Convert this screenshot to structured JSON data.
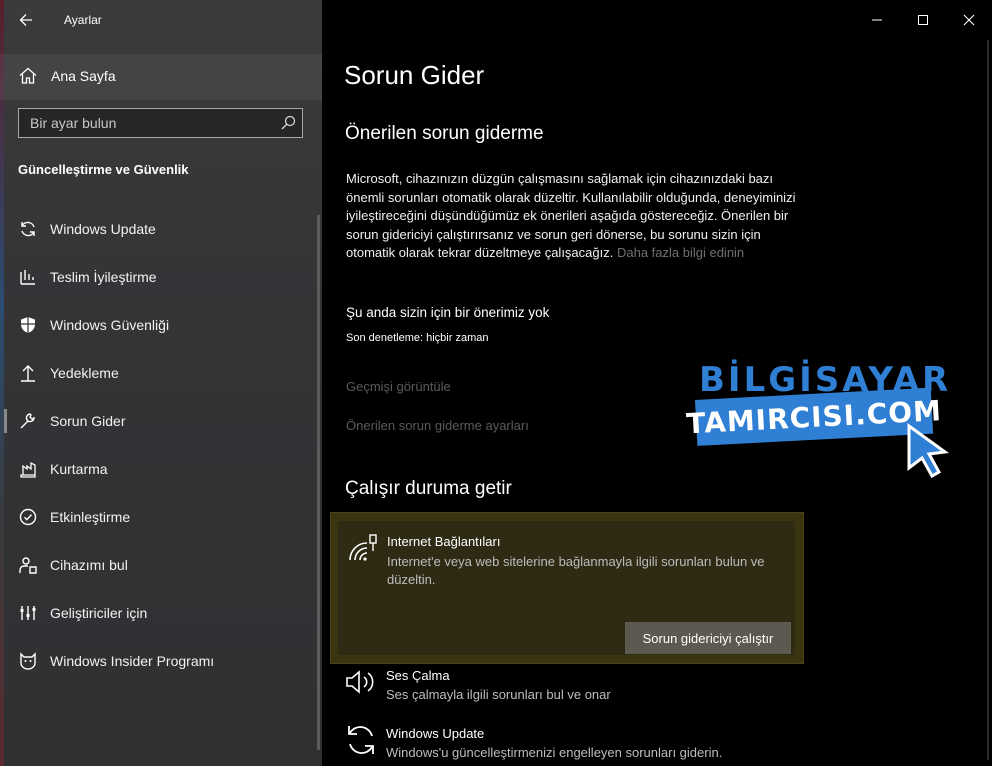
{
  "app": {
    "title": "Ayarlar",
    "home_label": "Ana Sayfa",
    "search_placeholder": "Bir ayar bulun",
    "section_title": "Güncelleştirme ve Güvenlik"
  },
  "sidebar": {
    "items": [
      {
        "label": "Windows Update",
        "icon": "refresh-icon"
      },
      {
        "label": "Teslim İyileştirme",
        "icon": "delivery-optimization-icon"
      },
      {
        "label": "Windows Güvenliği",
        "icon": "shield-icon"
      },
      {
        "label": "Yedekleme",
        "icon": "backup-arrow-icon"
      },
      {
        "label": "Sorun Gider",
        "icon": "wrench-icon"
      },
      {
        "label": "Kurtarma",
        "icon": "recovery-icon"
      },
      {
        "label": "Etkinleştirme",
        "icon": "check-circle-icon"
      },
      {
        "label": "Cihazımı bul",
        "icon": "person-location-icon"
      },
      {
        "label": "Geliştiriciler için",
        "icon": "developer-icon"
      },
      {
        "label": "Windows Insider Programı",
        "icon": "insider-cat-icon"
      }
    ]
  },
  "main": {
    "page_title": "Sorun Gider",
    "recommended_heading": "Önerilen sorun giderme",
    "description": "Microsoft, cihazınızın düzgün çalışmasını sağlamak için cihazınızdaki bazı önemli sorunları otomatik olarak düzeltir. Kullanılabilir olduğunda, deneyiminizi iyileştireceğini düşündüğümüz ek önerileri aşağıda göstereceğiz. Önerilen bir sorun gidericiyi çalıştırırsanız ve sorun geri dönerse, bu sorunu sizin için otomatik olarak tekrar düzeltmeye çalışacağız.",
    "learn_more": "Daha fazla bilgi edinin",
    "no_recommendation": "Şu anda sizin için bir önerimiz yok",
    "last_check": "Son denetleme: hiçbir zaman",
    "history_link": "Geçmişi görüntüle",
    "settings_link": "Önerilen sorun giderme ayarları",
    "get_running_heading": "Çalışır duruma getir",
    "troubleshooters": [
      {
        "title": "Internet Bağlantıları",
        "subtitle": "Internet'e veya web sitelerine bağlanmayla ilgili sorunları bulun ve düzeltin.",
        "button": "Sorun gidericiyi çalıştır",
        "icon": "wifi-icon"
      },
      {
        "title": "Ses Çalma",
        "subtitle": "Ses çalmayla ilgili sorunları bul ve onar",
        "icon": "speaker-icon"
      },
      {
        "title": "Windows Update",
        "subtitle": "Windows'u güncelleştirmenizi engelleyen sorunları giderin.",
        "icon": "refresh-icon"
      }
    ]
  },
  "watermark": {
    "line1": "BİLGİSAYAR",
    "line2": "TAMIRCISI.COM",
    "color": "#2f7fd4"
  },
  "colors": {
    "card_highlight": "#3a3410",
    "button_bg": "#5b5950"
  }
}
